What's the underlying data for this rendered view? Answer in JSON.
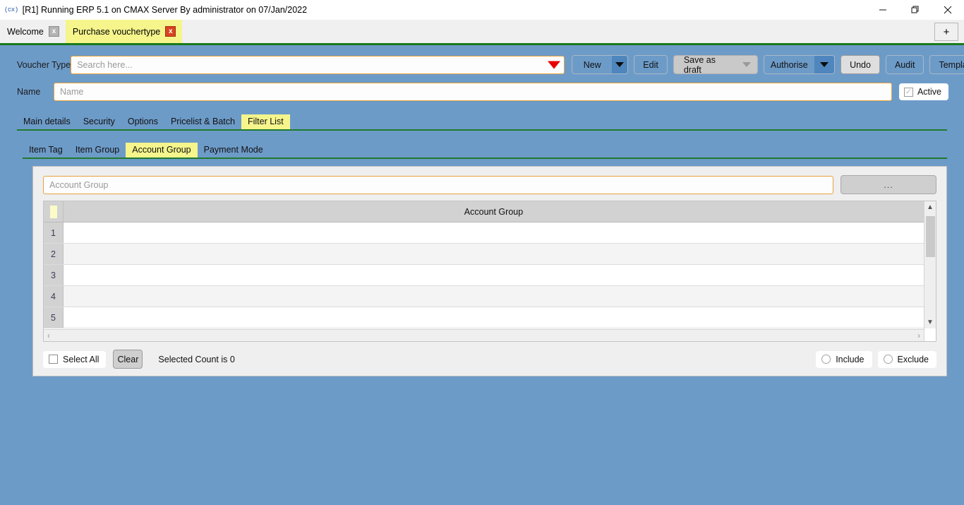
{
  "window": {
    "title": "[R1] Running ERP 5.1 on CMAX Server By administrator on 07/Jan/2022",
    "app_glyph": "(cx)",
    "minimize_label": "minimize-icon",
    "restore_label": "restore-icon",
    "close_label": "close-icon"
  },
  "tabstrip": {
    "tabs": [
      {
        "label": "Welcome",
        "active": false,
        "close": "x"
      },
      {
        "label": "Purchase vouchertype",
        "active": true,
        "close": "x"
      }
    ],
    "new_tab_label": "+"
  },
  "form": {
    "voucher_type_label": "Voucher Type",
    "voucher_type_placeholder": "Search here...",
    "voucher_type_value": "",
    "name_label": "Name",
    "name_placeholder": "Name",
    "name_value": "",
    "active_label": "Active"
  },
  "toolbar": {
    "new_label": "New",
    "edit_label": "Edit",
    "save_as_draft_label": "Save as draft",
    "authorise_label": "Authorise",
    "undo_label": "Undo",
    "audit_label": "Audit",
    "template_label": "Template"
  },
  "main_tabs": [
    {
      "label": "Main details",
      "active": false
    },
    {
      "label": "Security",
      "active": false
    },
    {
      "label": "Options",
      "active": false
    },
    {
      "label": "Pricelist & Batch",
      "active": false
    },
    {
      "label": "Filter List",
      "active": true
    }
  ],
  "sub_tabs": [
    {
      "label": "Item Tag",
      "active": false
    },
    {
      "label": "Item Group",
      "active": false
    },
    {
      "label": "Account Group",
      "active": true
    },
    {
      "label": "Payment Mode",
      "active": false
    }
  ],
  "filter_panel": {
    "search_placeholder": "Account Group",
    "search_value": "",
    "browse_label": "...",
    "grid": {
      "column_header": "Account Group",
      "row_numbers": [
        "1",
        "2",
        "3",
        "4",
        "5"
      ],
      "rows": [
        "",
        "",
        "",
        "",
        ""
      ]
    },
    "footer": {
      "select_all_label": "Select All",
      "clear_label": "Clear",
      "selected_count_text": "Selected Count is 0",
      "include_label": "Include",
      "exclude_label": "Exclude"
    }
  },
  "colors": {
    "form_background": "#6d9bc8",
    "active_tab": "#f5f58c",
    "tab_underline": "#1f7a2e",
    "input_border": "#e8a33d",
    "dropdown_arrow": "#e80000"
  }
}
